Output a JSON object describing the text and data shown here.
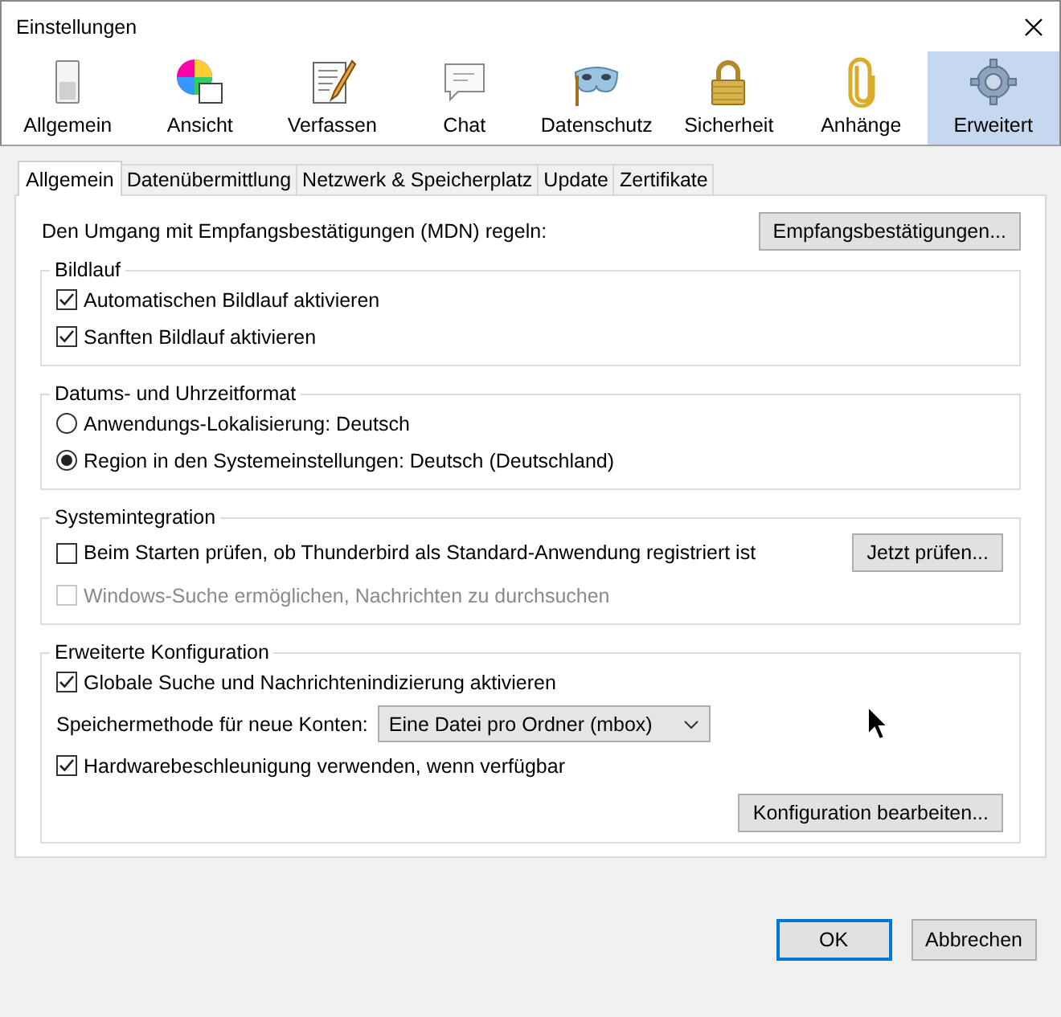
{
  "window": {
    "title": "Einstellungen"
  },
  "toolbar": [
    {
      "label": "Allgemein",
      "selected": false
    },
    {
      "label": "Ansicht",
      "selected": false
    },
    {
      "label": "Verfassen",
      "selected": false
    },
    {
      "label": "Chat",
      "selected": false
    },
    {
      "label": "Datenschutz",
      "selected": false
    },
    {
      "label": "Sicherheit",
      "selected": false
    },
    {
      "label": "Anhänge",
      "selected": false
    },
    {
      "label": "Erweitert",
      "selected": true
    }
  ],
  "tabs": [
    {
      "label": "Allgemein",
      "selected": true
    },
    {
      "label": "Datenübermittlung",
      "selected": false
    },
    {
      "label": "Netzwerk & Speicherplatz",
      "selected": false
    },
    {
      "label": "Update",
      "selected": false
    },
    {
      "label": "Zertifikate",
      "selected": false
    }
  ],
  "mdn": {
    "label": "Den Umgang mit Empfangsbestätigungen (MDN) regeln:",
    "button": "Empfangsbestätigungen..."
  },
  "groups": [
    {
      "title": "Bildlauf",
      "rows": [
        {
          "kind": "checkbox",
          "label": "Automatischen Bildlauf aktivieren",
          "checked": true,
          "disabled": false
        },
        {
          "kind": "checkbox",
          "label": "Sanften Bildlauf aktivieren",
          "checked": true,
          "disabled": false
        }
      ]
    },
    {
      "title": "Datums- und Uhrzeitformat",
      "rows": [
        {
          "kind": "radio",
          "label": "Anwendungs-Lokalisierung: Deutsch",
          "selected": false
        },
        {
          "kind": "radio",
          "label": "Region in den Systemeinstellungen: Deutsch (Deutschland)",
          "selected": true
        }
      ]
    },
    {
      "title": "Systemintegration",
      "rows": [
        {
          "kind": "checkbox",
          "label": "Beim Starten prüfen, ob Thunderbird als Standard-Anwendung registriert ist",
          "checked": false,
          "disabled": false,
          "button": "Jetzt prüfen..."
        },
        {
          "kind": "checkbox",
          "label": "Windows-Suche ermöglichen, Nachrichten zu durchsuchen",
          "checked": false,
          "disabled": true
        }
      ]
    },
    {
      "title": "Erweiterte Konfiguration",
      "rows": [
        {
          "kind": "checkbox",
          "label": "Globale Suche und Nachrichtenindizierung aktivieren",
          "checked": true,
          "disabled": false
        },
        {
          "kind": "select",
          "label": "Speichermethode für neue Konten:",
          "value": "Eine Datei pro Ordner (mbox)"
        },
        {
          "kind": "checkbox",
          "label": "Hardwarebeschleunigung verwenden, wenn verfügbar",
          "checked": true,
          "disabled": false
        },
        {
          "kind": "button",
          "button": "Konfiguration bearbeiten..."
        }
      ]
    }
  ],
  "buttons": [
    {
      "label": "OK",
      "focused": true
    },
    {
      "label": "Abbrechen",
      "focused": false
    }
  ]
}
